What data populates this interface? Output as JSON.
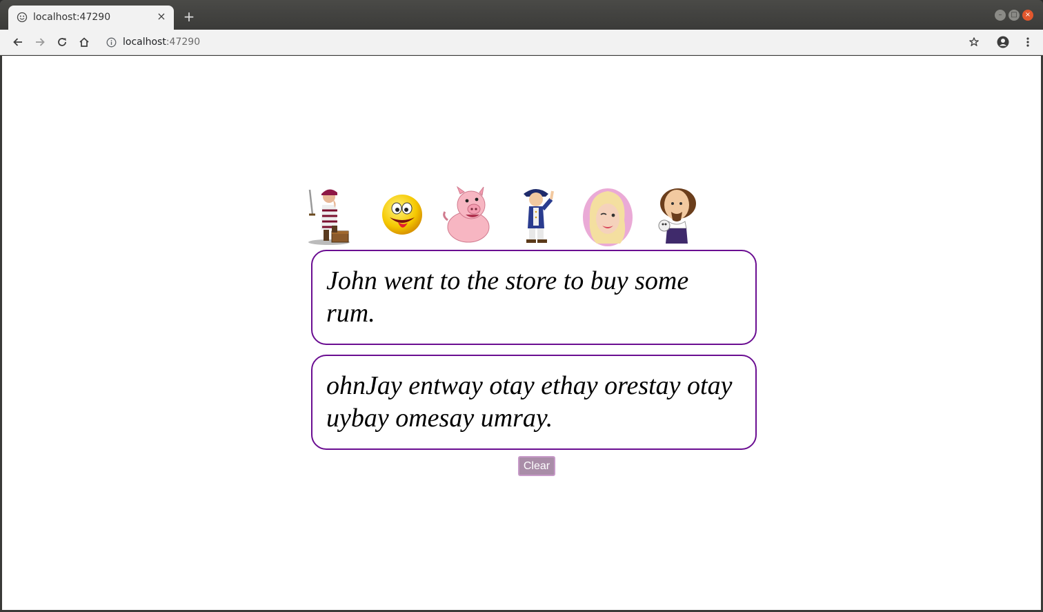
{
  "browser": {
    "tab_title": "localhost:47290",
    "tab_close_label": "×",
    "new_tab_label": "+",
    "url_host": "localhost",
    "url_port": ":47290"
  },
  "avatars": [
    {
      "name": "pirate"
    },
    {
      "name": "silly-emoji"
    },
    {
      "name": "pig"
    },
    {
      "name": "colonial-man"
    },
    {
      "name": "valley-girl"
    },
    {
      "name": "shakespeare"
    }
  ],
  "input_text": "John went to the store to buy some rum.",
  "output_text": "ohnJay entway otay ethay orestay otay uybay omesay umray.",
  "clear_label": "Clear",
  "colors": {
    "box_border": "#6a0d91",
    "clear_bg": "#a98da8"
  }
}
